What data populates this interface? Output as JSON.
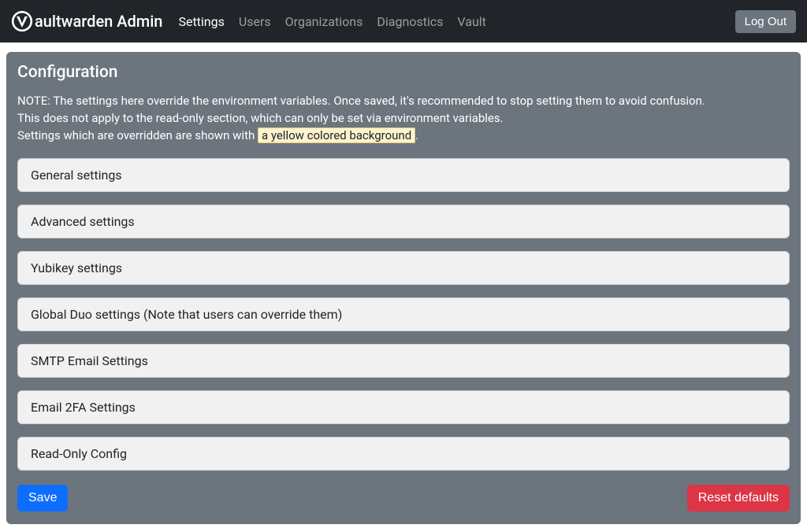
{
  "brand": {
    "text": "aultwarden Admin"
  },
  "nav": {
    "items": [
      {
        "label": "Settings",
        "active": true
      },
      {
        "label": "Users",
        "active": false
      },
      {
        "label": "Organizations",
        "active": false
      },
      {
        "label": "Diagnostics",
        "active": false
      },
      {
        "label": "Vault",
        "active": false
      }
    ],
    "logout": "Log Out"
  },
  "card": {
    "title": "Configuration",
    "note_line1": "NOTE: The settings here override the environment variables. Once saved, it's recommended to stop setting them to avoid confusion.",
    "note_line2": "This does not apply to the read-only section, which can only be set via environment variables.",
    "note_line3_prefix": "Settings which are overridden are shown with ",
    "note_line3_highlight": "a yellow colored background",
    "note_line3_suffix": "."
  },
  "accordion": {
    "items": [
      {
        "label": "General settings"
      },
      {
        "label": "Advanced settings"
      },
      {
        "label": "Yubikey settings"
      },
      {
        "label": "Global Duo settings (Note that users can override them)"
      },
      {
        "label": "SMTP Email Settings"
      },
      {
        "label": "Email 2FA Settings"
      },
      {
        "label": "Read-Only Config"
      }
    ]
  },
  "buttons": {
    "save": "Save",
    "reset": "Reset defaults"
  }
}
